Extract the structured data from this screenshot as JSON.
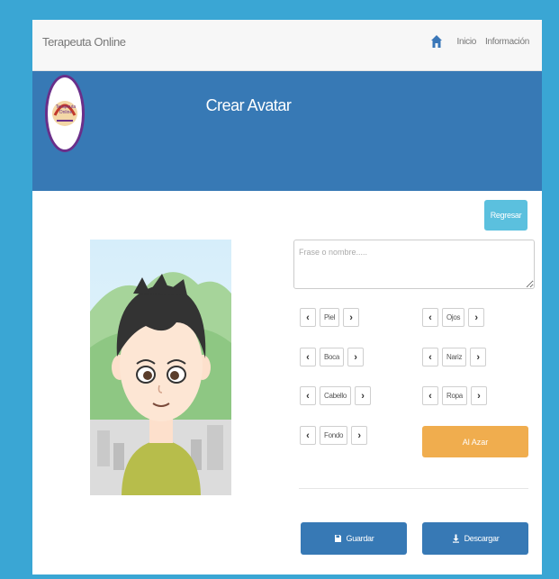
{
  "navbar": {
    "brand": "Terapeuta Online",
    "links": [
      {
        "label": "Inicio",
        "icon": "home-icon"
      },
      {
        "label": "Información"
      }
    ]
  },
  "hero": {
    "title": "Crear Avatar",
    "logo_text": "Terapeuta Online"
  },
  "back_button": {
    "label": "Regresar"
  },
  "phrase_input": {
    "placeholder": "Frase o nombre.....",
    "value": ""
  },
  "controls": {
    "left": [
      "Piel",
      "Boca",
      "Cabello",
      "Fondo"
    ],
    "right": [
      "Ojos",
      "Nariz",
      "Ropa"
    ]
  },
  "random_button": {
    "label": "Al Azar"
  },
  "actions": {
    "save": {
      "label": "Guardar",
      "icon": "save-icon"
    },
    "download": {
      "label": "Descargar",
      "icon": "download-icon"
    }
  },
  "colors": {
    "page_bg": "#3aa6d4",
    "hero": "#3779b5",
    "info_button": "#5bc0de",
    "warning_button": "#f0ad4e",
    "primary_button": "#3779b5"
  }
}
